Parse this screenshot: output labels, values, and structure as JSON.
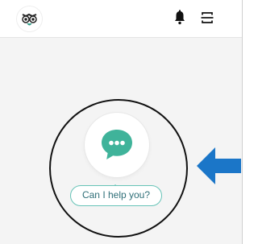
{
  "header": {
    "logo_icon": "owl-logo-icon",
    "notifications_icon": "bell-icon",
    "menu_icon": "menu-icon"
  },
  "chat_widget": {
    "icon": "chat-bubble-icon",
    "prompt": "Can I help you?",
    "accent_color": "#3fb39a",
    "bubble_border_color": "#67c3b7"
  },
  "annotation": {
    "arrow_icon": "left-arrow-icon",
    "arrow_color": "#1b76c8",
    "circle_color": "#111111"
  }
}
